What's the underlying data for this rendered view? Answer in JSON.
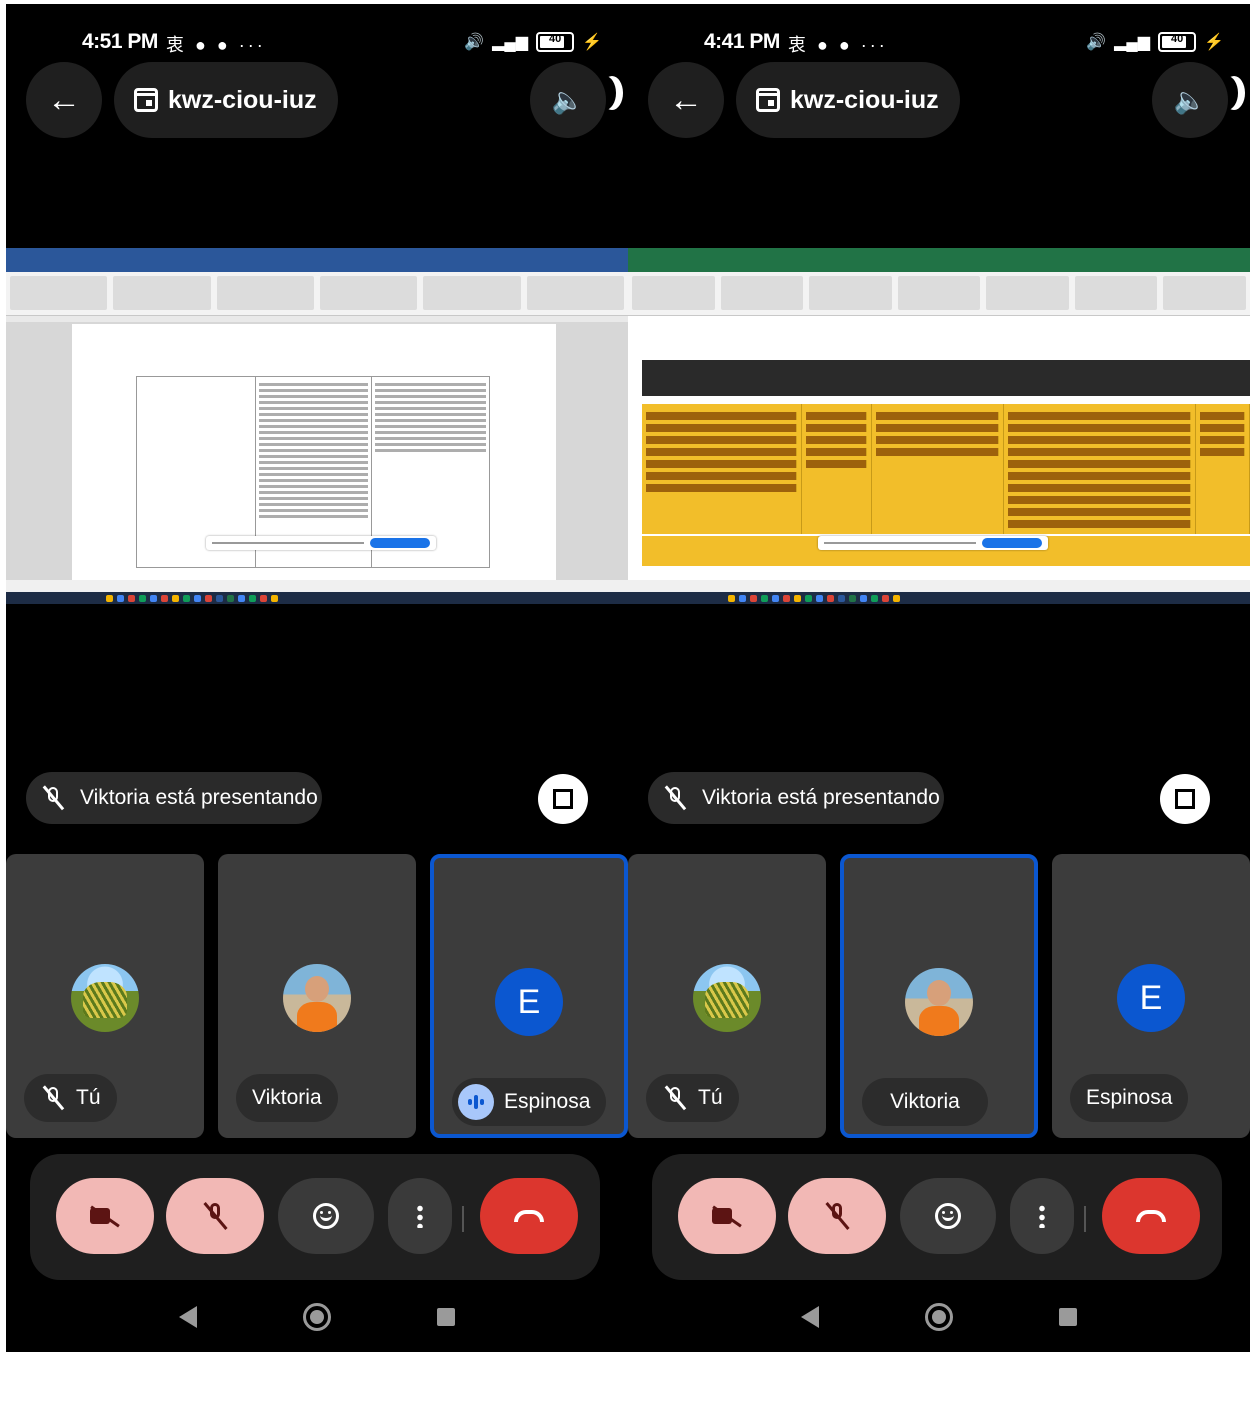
{
  "screens": [
    {
      "status": {
        "time": "4:51 PM",
        "icons": "衷 ● ● ···",
        "battery": "40"
      },
      "meeting_code": "kwz-ciou-iuz",
      "presenting_text": "Viktoria está presentando",
      "shared_content": "word-document",
      "participants": [
        {
          "name": "Tú",
          "muted": true,
          "avatar": "plant-photo"
        },
        {
          "name": "Viktoria",
          "muted": false,
          "avatar": "person-photo"
        },
        {
          "name": "Espinosa",
          "speaking": true,
          "avatar_letter": "E",
          "active": true
        }
      ]
    },
    {
      "status": {
        "time": "4:41 PM",
        "icons": "衷 ● ● ···",
        "battery": "40"
      },
      "meeting_code": "kwz-ciou-iuz",
      "presenting_text": "Viktoria está presentando",
      "shared_content": "excel-spreadsheet",
      "participants": [
        {
          "name": "Tú",
          "muted": true,
          "avatar": "plant-photo"
        },
        {
          "name": "Viktoria",
          "muted": false,
          "avatar": "person-photo",
          "active": true
        },
        {
          "name": "Espinosa",
          "avatar_letter": "E"
        }
      ]
    }
  ],
  "colors": {
    "active_border": "#0b57d0",
    "hangup": "#dc362e",
    "muted_button": "#f2b8b5",
    "excel_highlight": "#f2be2a"
  }
}
